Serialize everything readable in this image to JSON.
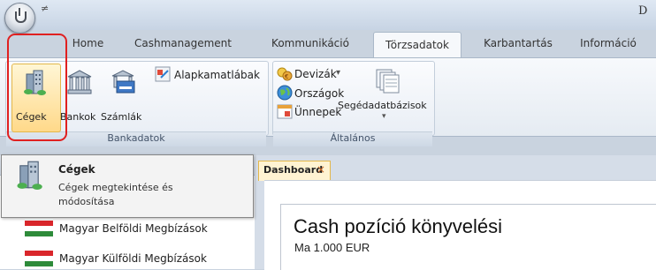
{
  "window": {
    "title_partial": "D",
    "quick_access": "≠"
  },
  "tabs": [
    {
      "label": "Home"
    },
    {
      "label": "Cashmanagement"
    },
    {
      "label": "Kommunikáció"
    },
    {
      "label": "Törzsadatok",
      "active": true
    },
    {
      "label": "Karbantartás"
    },
    {
      "label": "Információ"
    }
  ],
  "ribbon": {
    "bankadatok": {
      "group_label": "Bankadatok",
      "buttons": [
        {
          "label": "Cégek",
          "icon": "buildings-icon",
          "highlighted": true
        },
        {
          "label": "Bankok",
          "icon": "bank-icon"
        },
        {
          "label": "Számlák",
          "icon": "account-icon"
        },
        {
          "label": "Alapkamatlábak",
          "icon": "rates-icon"
        }
      ]
    },
    "altalanos": {
      "group_label": "Általános",
      "buttons": [
        {
          "label": "Devizák",
          "icon": "currency-icon",
          "dropdown": "▾"
        },
        {
          "label": "Országok",
          "icon": "globe-icon"
        },
        {
          "label": "Ünnepek",
          "icon": "calendar-icon"
        },
        {
          "label": "Segédadatbázisok",
          "icon": "database-icon",
          "dropdown": "▾"
        }
      ]
    }
  },
  "tooltip": {
    "title": "Cégek",
    "desc_line1": "Cégek megtekintése és",
    "desc_line2": "módosítása"
  },
  "left_pane": {
    "items": [
      {
        "label": "Magyar Belföldi Megbízások",
        "icon": "hungarian-flag-icon"
      },
      {
        "label": "Magyar Külföldi Megbízások",
        "icon": "hungarian-flag-icon"
      }
    ],
    "close": "×"
  },
  "document": {
    "tab_label": "Dashboard",
    "tab_close": "×",
    "heading": "Cash pozíció könyvelési",
    "subheading": "Ma 1.000 EUR"
  },
  "colors": {
    "accent": "#e02020",
    "active_tab_border": "#e3b74a"
  }
}
